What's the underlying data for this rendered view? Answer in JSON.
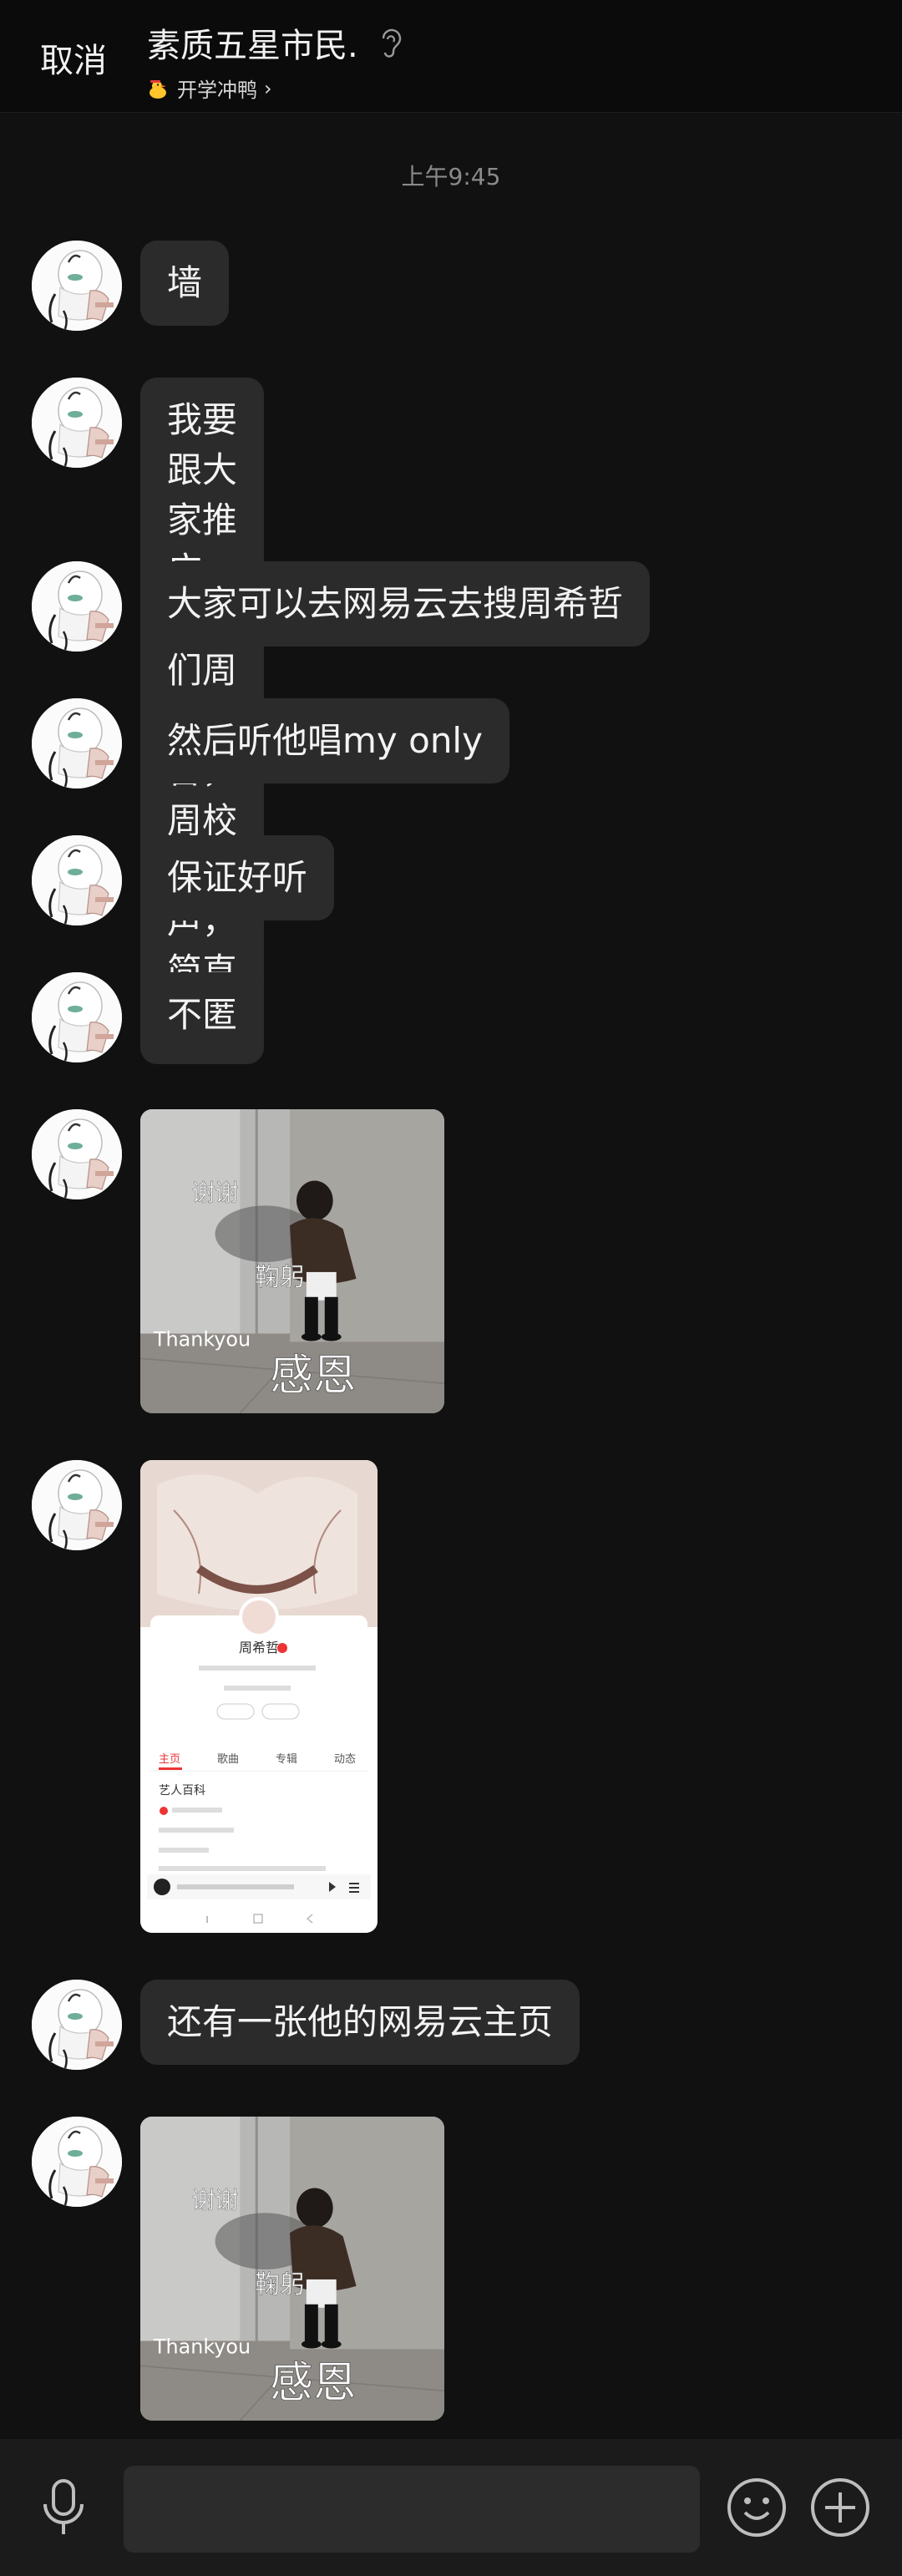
{
  "header": {
    "cancel_label": "取消",
    "title": "素质五星市民.",
    "subtitle": "开学冲鸭",
    "subtitle_chevron": "›"
  },
  "timestamp": "上午9:45",
  "messages": [
    {
      "type": "text",
      "text": "墙"
    },
    {
      "type": "text",
      "lines": [
        "我要跟大家推广一下我们周希哲，",
        "周校的歌声，简直无敌"
      ]
    },
    {
      "type": "text",
      "text": "大家可以去网易云去搜周希哲"
    },
    {
      "type": "text",
      "text": "然后听他唱my only"
    },
    {
      "type": "text",
      "text": "保证好听"
    },
    {
      "type": "text",
      "text": "不匿"
    },
    {
      "type": "image",
      "caption_lines": [
        "谢谢",
        "鞠躬",
        "Thankyou",
        "感恩"
      ]
    },
    {
      "type": "screenshot",
      "profile_name": "周希哲",
      "tabs": [
        "主页",
        "歌曲",
        "专辑",
        "动态"
      ],
      "section_title": "艺人百科"
    },
    {
      "type": "text",
      "text": "还有一张他的网易云主页"
    },
    {
      "type": "image",
      "caption_lines": [
        "谢谢",
        "鞠躬",
        "Thankyou",
        "感恩"
      ]
    }
  ],
  "colors": {
    "background": "#111111",
    "bubble": "#2b2b2b",
    "header": "#0b0b0b",
    "bottom_bar": "#1b1b1b",
    "input": "#2c2c2c"
  },
  "icons": {
    "ear": "ear-icon",
    "duck": "duck-icon",
    "mic": "microphone-icon",
    "emoji": "emoji-icon",
    "plus": "plus-icon"
  }
}
